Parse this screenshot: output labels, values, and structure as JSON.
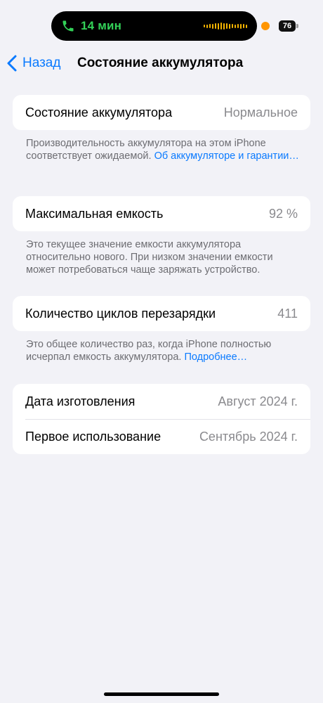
{
  "status_bar": {
    "call_time": "14 мин",
    "battery_level": "76",
    "battery_fraction": 0.76,
    "accent_call": "#33d158",
    "accent_privacy": "#ff9500"
  },
  "nav": {
    "back_label": "Назад",
    "title": "Состояние аккумулятора"
  },
  "health": {
    "label": "Состояние аккумулятора",
    "value": "Нормальное",
    "note": "Производительность аккумулятора на этом iPhone соответствует ожидаемой. ",
    "note_link": "Об аккумуляторе и гарантии…"
  },
  "capacity": {
    "label": "Максимальная емкость",
    "value": "92 %",
    "note": "Это текущее значение емкости аккумулятора относительно нового. При низком значении емкости может потребоваться чаще заряжать устройство."
  },
  "cycles": {
    "label": "Количество циклов перезарядки",
    "value": "411",
    "note": "Это общее количество раз, когда iPhone полностью исчерпал емкость аккумулятора. ",
    "note_link": "Подробнее…"
  },
  "dates": {
    "manufacture_label": "Дата изготовления",
    "manufacture_value": "Август 2024 г.",
    "first_use_label": "Первое использование",
    "first_use_value": "Сентябрь 2024 г."
  },
  "icons": {
    "call": "phone-icon",
    "back": "chevron-left-icon",
    "audio": "waveform-icon"
  },
  "colors": {
    "link": "#0a7aff",
    "background": "#f2f2f7",
    "secondary_text": "#8a8a8e"
  }
}
